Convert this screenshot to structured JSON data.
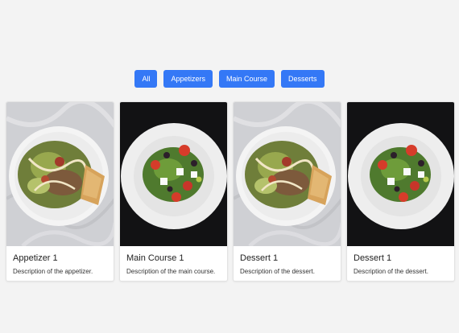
{
  "filters": [
    {
      "label": "All"
    },
    {
      "label": "Appetizers"
    },
    {
      "label": "Main Course"
    },
    {
      "label": "Desserts"
    }
  ],
  "cards": [
    {
      "title": "Appetizer 1",
      "description": "Description of the appetizer.",
      "image": "caesar-salad-on-marble"
    },
    {
      "title": "Main Course 1",
      "description": "Description of the main course.",
      "image": "greek-salad-on-dark"
    },
    {
      "title": "Dessert 1",
      "description": "Description of the dessert.",
      "image": "caesar-salad-on-marble"
    },
    {
      "title": "Dessert 1",
      "description": "Description of the dessert.",
      "image": "greek-salad-on-dark"
    }
  ],
  "colors": {
    "accent": "#3478f6",
    "background": "#f3f3f3"
  }
}
